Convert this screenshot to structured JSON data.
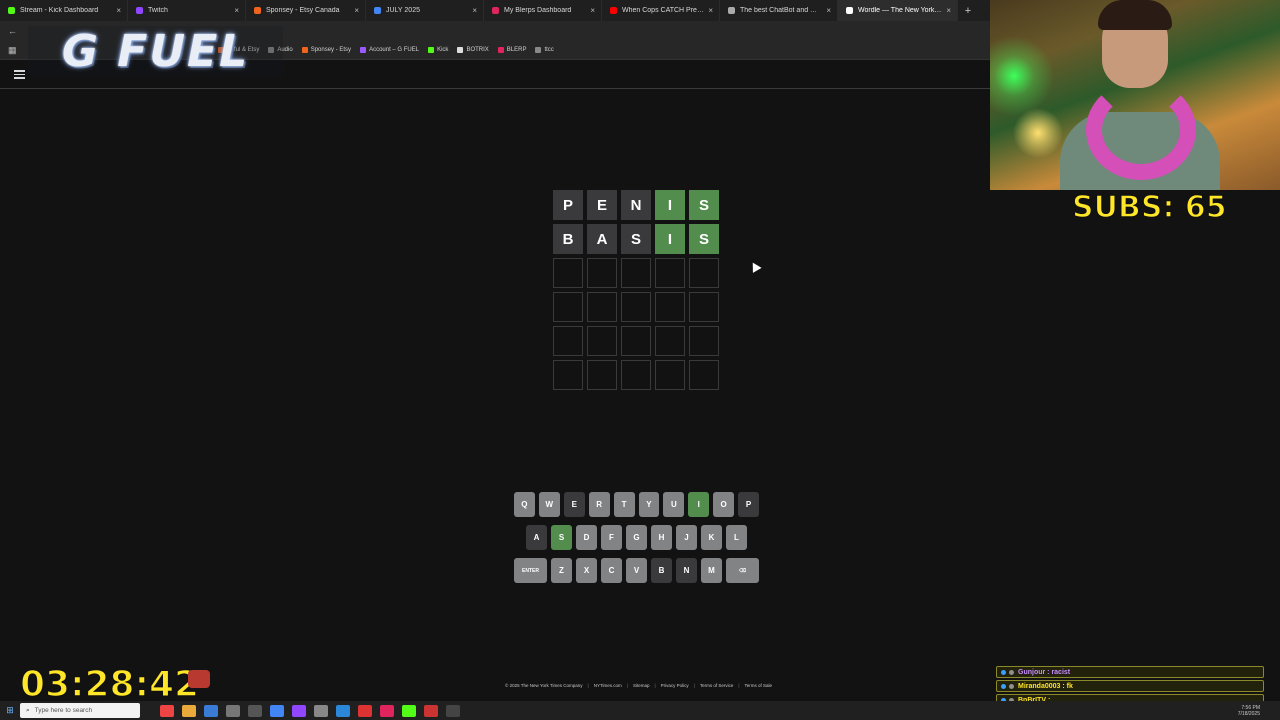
{
  "browser": {
    "tabs": [
      {
        "label": "Stream - Kick Dashboard",
        "favicon_color": "#53fc18",
        "active": false
      },
      {
        "label": "Twitch",
        "favicon_color": "#9146ff",
        "active": false
      },
      {
        "label": "Sponsey - Etsy Canada",
        "favicon_color": "#f1641e",
        "active": false
      },
      {
        "label": "JULY 2025",
        "favicon_color": "#4285f4",
        "active": false
      },
      {
        "label": "My Blerps Dashboard",
        "favicon_color": "#e0245e",
        "active": false
      },
      {
        "label": "When Cops CATCH Predators i...",
        "favicon_color": "#ff0000",
        "active": false
      },
      {
        "label": "The best ChatBot and Widgets...",
        "favicon_color": "#aaaaaa",
        "active": false
      },
      {
        "label": "Wordle — The New York Times",
        "favicon_color": "#ffffff",
        "active": true
      }
    ],
    "tab_close": "×",
    "new_tab": "+",
    "bookmarks": [
      {
        "label": "ertful & Etsy",
        "color": "#f1641e"
      },
      {
        "label": "Audio",
        "color": "#888888"
      },
      {
        "label": "Sponsey - Etsy",
        "color": "#f1641e"
      },
      {
        "label": "Account – G FUEL",
        "color": "#9b59ff"
      },
      {
        "label": "Kick",
        "color": "#53fc18"
      },
      {
        "label": "BOTRIX",
        "color": "#dddddd"
      },
      {
        "label": "BLERP",
        "color": "#e0245e"
      },
      {
        "label": "ttcc",
        "color": "#888888"
      }
    ]
  },
  "overlay": {
    "gfuel_logo": "G FUEL",
    "subs": "SUBS: 65",
    "timer": "03:28:42",
    "chat": [
      {
        "text": "Gunjour : racist",
        "color": "#c98cff"
      },
      {
        "text": "Miranda0003 : fk",
        "color": "#ffe628"
      },
      {
        "text": "BnBrITV :",
        "color": "#ffe628"
      }
    ]
  },
  "wordle": {
    "board": [
      [
        {
          "l": "P",
          "s": "absent"
        },
        {
          "l": "E",
          "s": "absent"
        },
        {
          "l": "N",
          "s": "absent"
        },
        {
          "l": "I",
          "s": "correct"
        },
        {
          "l": "S",
          "s": "correct"
        }
      ],
      [
        {
          "l": "B",
          "s": "absent"
        },
        {
          "l": "A",
          "s": "absent"
        },
        {
          "l": "S",
          "s": "absent"
        },
        {
          "l": "I",
          "s": "correct"
        },
        {
          "l": "S",
          "s": "correct"
        }
      ],
      [
        {
          "l": "",
          "s": "empty"
        },
        {
          "l": "",
          "s": "empty"
        },
        {
          "l": "",
          "s": "empty"
        },
        {
          "l": "",
          "s": "empty"
        },
        {
          "l": "",
          "s": "empty"
        }
      ],
      [
        {
          "l": "",
          "s": "empty"
        },
        {
          "l": "",
          "s": "empty"
        },
        {
          "l": "",
          "s": "empty"
        },
        {
          "l": "",
          "s": "empty"
        },
        {
          "l": "",
          "s": "empty"
        }
      ],
      [
        {
          "l": "",
          "s": "empty"
        },
        {
          "l": "",
          "s": "empty"
        },
        {
          "l": "",
          "s": "empty"
        },
        {
          "l": "",
          "s": "empty"
        },
        {
          "l": "",
          "s": "empty"
        }
      ],
      [
        {
          "l": "",
          "s": "empty"
        },
        {
          "l": "",
          "s": "empty"
        },
        {
          "l": "",
          "s": "empty"
        },
        {
          "l": "",
          "s": "empty"
        },
        {
          "l": "",
          "s": "empty"
        }
      ]
    ],
    "keyboard": [
      [
        {
          "k": "Q",
          "s": ""
        },
        {
          "k": "W",
          "s": ""
        },
        {
          "k": "E",
          "s": "absent"
        },
        {
          "k": "R",
          "s": ""
        },
        {
          "k": "T",
          "s": ""
        },
        {
          "k": "Y",
          "s": ""
        },
        {
          "k": "U",
          "s": ""
        },
        {
          "k": "I",
          "s": "correct"
        },
        {
          "k": "O",
          "s": ""
        },
        {
          "k": "P",
          "s": "absent"
        }
      ],
      [
        {
          "k": "A",
          "s": "absent"
        },
        {
          "k": "S",
          "s": "correct"
        },
        {
          "k": "D",
          "s": ""
        },
        {
          "k": "F",
          "s": ""
        },
        {
          "k": "G",
          "s": ""
        },
        {
          "k": "H",
          "s": ""
        },
        {
          "k": "J",
          "s": ""
        },
        {
          "k": "K",
          "s": ""
        },
        {
          "k": "L",
          "s": ""
        }
      ],
      [
        {
          "k": "ENTER",
          "s": "",
          "wide": true
        },
        {
          "k": "Z",
          "s": ""
        },
        {
          "k": "X",
          "s": ""
        },
        {
          "k": "C",
          "s": ""
        },
        {
          "k": "V",
          "s": ""
        },
        {
          "k": "B",
          "s": "absent"
        },
        {
          "k": "N",
          "s": "absent"
        },
        {
          "k": "M",
          "s": ""
        },
        {
          "k": "⌫",
          "s": "",
          "wide": true
        }
      ]
    ],
    "footer": [
      "© 2025 The New York Times Company",
      "NYTimes.com",
      "Sitemap",
      "Privacy Policy",
      "Terms of Service",
      "Terms of Sale"
    ]
  },
  "taskbar": {
    "search_placeholder": "Type here to search",
    "time": "7:56 PM",
    "date": "7/18/2025"
  }
}
